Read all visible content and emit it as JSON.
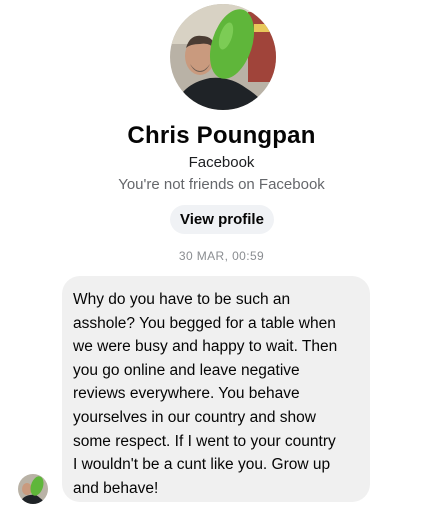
{
  "profile": {
    "name": "Chris Poungpan",
    "platform": "Facebook",
    "friend_status": "You're not friends on Facebook",
    "view_profile_label": "View profile",
    "avatar_icon": "profile-photo"
  },
  "conversation": {
    "timestamp": "30 MAR, 00:59",
    "messages": [
      {
        "sender": "Chris Poungpan",
        "text": "Why do you have to be such an\nasshole? You begged for a table when\nwe were busy and happy to wait. Then\nyou go online and leave negative\nreviews everywhere. You behave\nyourselves in our country and show\nsome respect. If I went to your country\nI wouldn't be a cunt like you. Grow up\nand behave!"
      }
    ]
  },
  "colors": {
    "bubble_background": "#f0f0f0",
    "button_background": "#f0f2f5",
    "secondary_text": "#65676b",
    "timestamp_text": "#8a8d91"
  }
}
